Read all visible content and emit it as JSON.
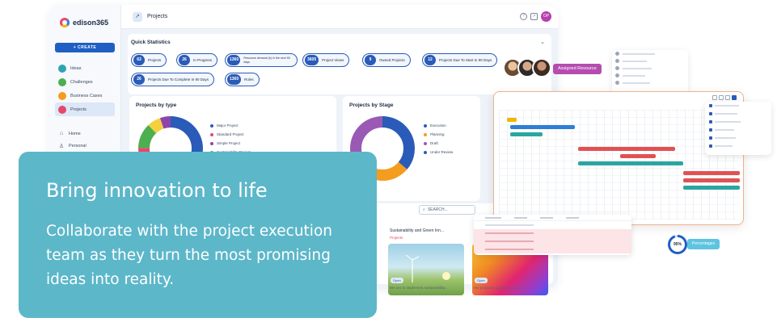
{
  "brand": {
    "name": "edison365"
  },
  "sidebar": {
    "create_label": "+ CREATE",
    "items": [
      {
        "label": "Ideas",
        "color": "#2fa3b6"
      },
      {
        "label": "Challenges",
        "color": "#4caf50"
      },
      {
        "label": "Business Cases",
        "color": "#f39c1f"
      },
      {
        "label": "Projects",
        "color": "#e5486a"
      }
    ],
    "secondary": [
      {
        "label": "Home",
        "icon": "home-icon"
      },
      {
        "label": "Personal",
        "icon": "person-icon"
      }
    ]
  },
  "header": {
    "title": "Projects",
    "avatar_initials": "OP"
  },
  "quick_stats": {
    "title": "Quick Statistics",
    "pills": [
      {
        "num": "63",
        "label": "Projects"
      },
      {
        "num": "26",
        "label": "In Progress"
      },
      {
        "num": "1360",
        "label": "Resource demand (h) in the next 90 days"
      },
      {
        "num": "3605",
        "label": "Project Views"
      },
      {
        "num": "9",
        "label": "Owned Projects"
      },
      {
        "num": "12",
        "label": "Projects Due To Start In 90 Days"
      },
      {
        "num": "26",
        "label": "Projects Due To Complete In 90 Days"
      },
      {
        "num": "1360",
        "label": "Roles"
      }
    ]
  },
  "projects_by_type": {
    "title": "Projects by type",
    "legend": [
      {
        "label": "Major Project",
        "color": "#2a5bb8"
      },
      {
        "label": "Standard Project",
        "color": "#e5486a"
      },
      {
        "label": "Simple Project",
        "color": "#8e44ad"
      },
      {
        "label": "Sustainability Project",
        "color": "#4caf50"
      }
    ]
  },
  "projects_by_stage": {
    "title": "Projects by Stage",
    "legend": [
      {
        "label": "Execution",
        "color": "#2a5bb8"
      },
      {
        "label": "Planning",
        "color": "#f39c1f"
      },
      {
        "label": "Draft",
        "color": "#9b59b6"
      },
      {
        "label": "Under Review",
        "color": "#2a5bb8"
      }
    ]
  },
  "search": {
    "label": "SEARCH..."
  },
  "ideas": [
    {
      "title": "Sustainability and Green Inn...",
      "badge": "Projects",
      "caption": "We are to implement sustainability..."
    },
    {
      "title": "",
      "badge": "",
      "caption": "We propose upgrading our IT..."
    }
  ],
  "open_label": "Open",
  "assigned_resource": "Assigned Resource",
  "percentage": {
    "value": "95%",
    "label": "Percentages"
  },
  "hero": {
    "title": "Bring innovation to life",
    "body": "Collaborate with the project execution team as they turn the most promising ideas into reality."
  }
}
